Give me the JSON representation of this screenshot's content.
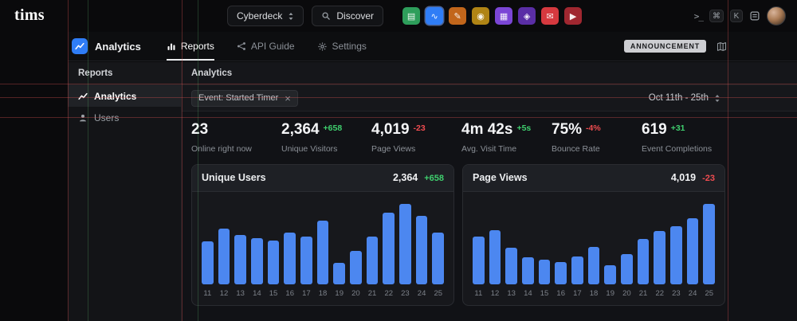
{
  "topbar": {
    "logo": "tims",
    "workspace_button": {
      "label": "Cyberdeck"
    },
    "discover_button": {
      "label": "Discover"
    },
    "shortcut": {
      "prompt": ">_",
      "keys": [
        "⌘",
        "K"
      ]
    },
    "app_icons": [
      {
        "name": "docs-app-icon",
        "color": "#2e9e5b",
        "glyph": "▤",
        "active": false
      },
      {
        "name": "analytics-app-icon",
        "color": "#2f7df6",
        "glyph": "∿",
        "active": true
      },
      {
        "name": "notes-app-icon",
        "color": "#c2661b",
        "glyph": "✎",
        "active": false
      },
      {
        "name": "coins-app-icon",
        "color": "#b08415",
        "glyph": "◉",
        "active": false
      },
      {
        "name": "calendar-app-icon",
        "color": "#7b46d6",
        "glyph": "▦",
        "active": false
      },
      {
        "name": "vault-app-icon",
        "color": "#5a2ea6",
        "glyph": "◈",
        "active": false
      },
      {
        "name": "mail-app-icon",
        "color": "#d6393f",
        "glyph": "✉",
        "active": false
      },
      {
        "name": "media-app-icon",
        "color": "#a02730",
        "glyph": "▶",
        "active": false
      }
    ]
  },
  "header": {
    "title": "Analytics",
    "tabs": [
      {
        "label": "Reports",
        "icon": "bar-chart",
        "active": true
      },
      {
        "label": "API Guide",
        "icon": "share-nodes",
        "active": false
      },
      {
        "label": "Settings",
        "icon": "gear",
        "active": false
      }
    ],
    "badge": "ANNOUNCEMENT"
  },
  "sidebar": {
    "title": "Reports",
    "items": [
      {
        "label": "Analytics",
        "icon": "chart-line",
        "active": true
      },
      {
        "label": "Users",
        "icon": "person",
        "active": false
      }
    ]
  },
  "main": {
    "title": "Analytics",
    "filter": {
      "chip": "Event: Started Timer"
    },
    "date_range": "Oct 11th - 25th",
    "stats": [
      {
        "value": "23",
        "delta": "",
        "delta_color": "",
        "label": "Online right now"
      },
      {
        "value": "2,364",
        "delta": "+658",
        "delta_color": "green",
        "label": "Unique Visitors"
      },
      {
        "value": "4,019",
        "delta": "-23",
        "delta_color": "red",
        "label": "Page Views"
      },
      {
        "value": "4m 42s",
        "delta": "+5s",
        "delta_color": "green",
        "label": "Avg. Visit Time"
      },
      {
        "value": "75%",
        "delta": "-4%",
        "delta_color": "red",
        "label": "Bounce Rate"
      },
      {
        "value": "619",
        "delta": "+31",
        "delta_color": "green",
        "label": "Event Completions"
      }
    ]
  },
  "chart_data": [
    {
      "type": "bar",
      "title": "Unique Users",
      "total": "2,364",
      "delta": "+658",
      "delta_color": "green",
      "categories": [
        "11",
        "12",
        "13",
        "14",
        "15",
        "16",
        "17",
        "18",
        "19",
        "20",
        "21",
        "22",
        "23",
        "24",
        "25"
      ],
      "values": [
        52,
        67,
        60,
        56,
        53,
        62,
        58,
        77,
        26,
        40,
        58,
        86,
        97,
        83,
        62
      ],
      "ylim": [
        0,
        100
      ],
      "grid": false,
      "legend": false,
      "xlabel": "",
      "ylabel": ""
    },
    {
      "type": "bar",
      "title": "Page Views",
      "total": "4,019",
      "delta": "-23",
      "delta_color": "red",
      "categories": [
        "11",
        "12",
        "13",
        "14",
        "15",
        "16",
        "17",
        "18",
        "19",
        "20",
        "21",
        "22",
        "23",
        "24",
        "25"
      ],
      "values": [
        58,
        65,
        44,
        33,
        30,
        27,
        34,
        45,
        23,
        36,
        55,
        64,
        70,
        80,
        97
      ],
      "ylim": [
        0,
        100
      ],
      "grid": false,
      "legend": false,
      "xlabel": "",
      "ylabel": ""
    }
  ],
  "colors": {
    "accent_blue": "#2f7df6",
    "bar_blue": "#4c87f0",
    "green": "#3fcf6e",
    "red": "#ef4c50"
  }
}
